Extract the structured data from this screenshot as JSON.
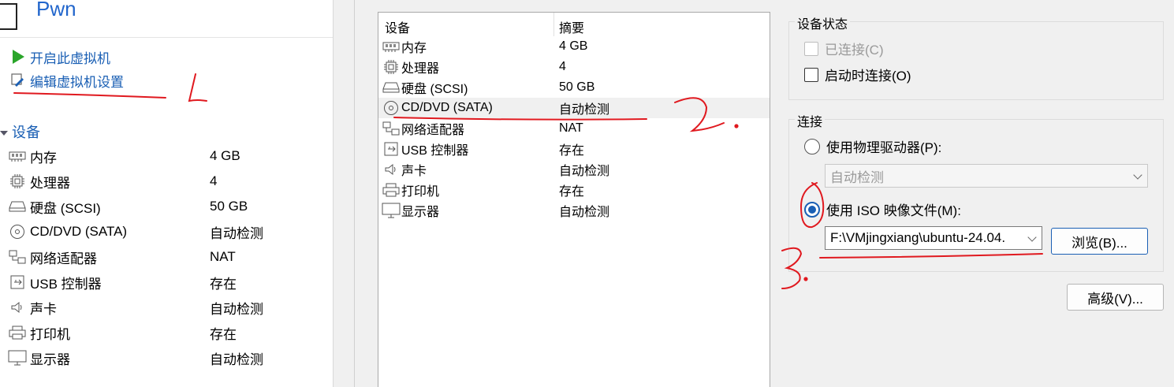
{
  "vm": {
    "title": "Pwn",
    "actions": [
      {
        "label": "开启此虚拟机",
        "icon": "play-icon"
      },
      {
        "label": "编辑虚拟机设置",
        "icon": "edit-settings-icon"
      }
    ],
    "devices_section_title": "设备",
    "devices": [
      {
        "name": "内存",
        "value": "4 GB",
        "icon": "memory-icon"
      },
      {
        "name": "处理器",
        "value": "4",
        "icon": "processor-icon"
      },
      {
        "name": "硬盘 (SCSI)",
        "value": "50 GB",
        "icon": "hard-disk-icon"
      },
      {
        "name": "CD/DVD (SATA)",
        "value": "自动检测",
        "icon": "cd-dvd-icon"
      },
      {
        "name": "网络适配器",
        "value": "NAT",
        "icon": "network-adapter-icon"
      },
      {
        "name": "USB 控制器",
        "value": "存在",
        "icon": "usb-icon"
      },
      {
        "name": "声卡",
        "value": "自动检测",
        "icon": "sound-card-icon"
      },
      {
        "name": "打印机",
        "value": "存在",
        "icon": "printer-icon"
      },
      {
        "name": "显示器",
        "value": "自动检测",
        "icon": "display-icon"
      }
    ]
  },
  "settings_table": {
    "col_device": "设备",
    "col_summary": "摘要",
    "selected_index": 3,
    "rows": [
      {
        "name": "内存",
        "value": "4 GB"
      },
      {
        "name": "处理器",
        "value": "4"
      },
      {
        "name": "硬盘 (SCSI)",
        "value": "50 GB"
      },
      {
        "name": "CD/DVD (SATA)",
        "value": "自动检测"
      },
      {
        "name": "网络适配器",
        "value": "NAT"
      },
      {
        "name": "USB 控制器",
        "value": "存在"
      },
      {
        "name": "声卡",
        "value": "自动检测"
      },
      {
        "name": "打印机",
        "value": "存在"
      },
      {
        "name": "显示器",
        "value": "自动检测"
      }
    ]
  },
  "device_status": {
    "title": "设备状态",
    "connected_label": "已连接(C)",
    "connected_checked": false,
    "connect_on_power_label": "启动时连接(O)",
    "connect_on_power_checked": false
  },
  "connection": {
    "title": "连接",
    "physical_label": "使用物理驱动器(P):",
    "physical_value": "自动检测",
    "iso_label": "使用 ISO 映像文件(M):",
    "iso_value": "F:\\VMjingxiang\\ubuntu-24.04.",
    "iso_selected": true,
    "browse_label": "浏览(B)..."
  },
  "advanced_label": "高级(V)...",
  "annotations": {
    "mark_1": "1.",
    "mark_2": "2.",
    "mark_3": "3.",
    "color": "#e0191f"
  },
  "colors": {
    "link_blue": "#1a5fb4",
    "play_green": "#2aa52a",
    "title_blue": "#2266cc"
  }
}
